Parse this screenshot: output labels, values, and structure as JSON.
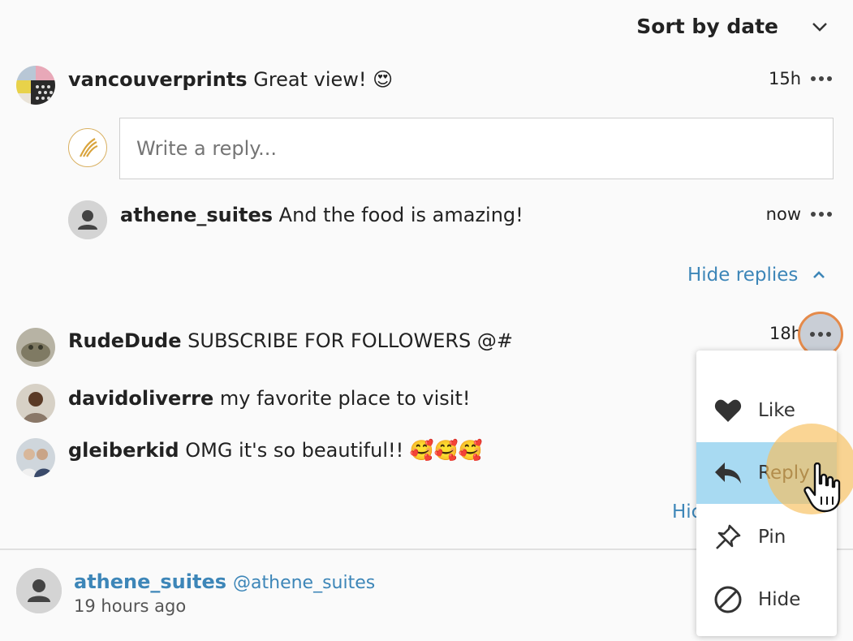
{
  "sort": {
    "label": "Sort by date",
    "icon": "chevron-down-icon"
  },
  "comments": [
    {
      "author": "vancouverprints",
      "text": "Great view! 😍",
      "time": "15h"
    },
    {
      "author": "RudeDude",
      "text": "SUBSCRIBE FOR FOLLOWERS @#",
      "time": "18h"
    },
    {
      "author": "davidoliverre",
      "text": "my favorite place to visit!"
    },
    {
      "author": "gleiberkid",
      "text": "OMG it's so beautiful!! 🥰🥰🥰"
    }
  ],
  "reply_box": {
    "placeholder": "Write a reply..."
  },
  "replies": [
    {
      "author": "athene_suites",
      "text": "And the food is amazing!",
      "time": "now"
    }
  ],
  "hide_replies": {
    "label": "Hide replies",
    "partial": "Hic"
  },
  "author_footer": {
    "name": "athene_suites",
    "handle": "@athene_suites",
    "time": "19 hours ago"
  },
  "context_menu": {
    "items": [
      {
        "label": "Like",
        "icon": "heart-icon"
      },
      {
        "label": "Reply",
        "icon": "reply-arrow-icon",
        "highlighted": true
      },
      {
        "label": "Pin",
        "icon": "pin-icon"
      },
      {
        "label": "Hide",
        "icon": "block-icon"
      }
    ]
  },
  "colors": {
    "link": "#3d86b8",
    "highlight": "#a8daf2",
    "ring": "#e58a4a",
    "cursor_halo": "#f8be5a"
  }
}
